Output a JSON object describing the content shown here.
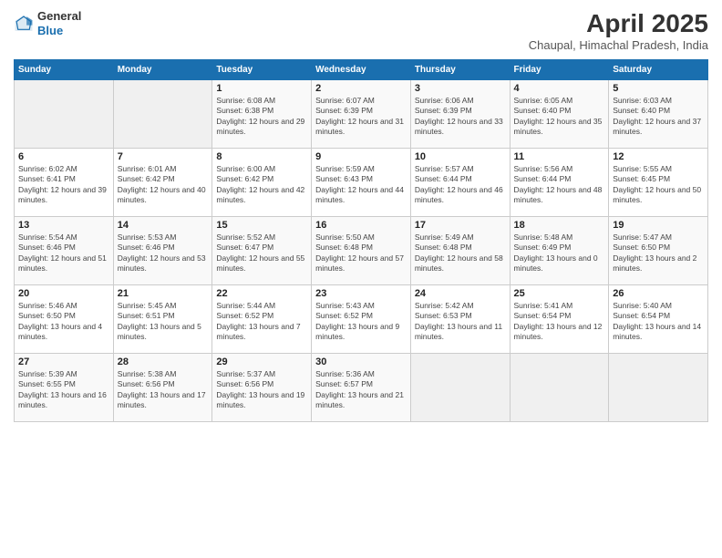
{
  "header": {
    "logo_line1": "General",
    "logo_line2": "Blue",
    "title": "April 2025",
    "location": "Chaupal, Himachal Pradesh, India"
  },
  "weekdays": [
    "Sunday",
    "Monday",
    "Tuesday",
    "Wednesday",
    "Thursday",
    "Friday",
    "Saturday"
  ],
  "weeks": [
    [
      {
        "day": "",
        "sunrise": "",
        "sunset": "",
        "daylight": ""
      },
      {
        "day": "",
        "sunrise": "",
        "sunset": "",
        "daylight": ""
      },
      {
        "day": "1",
        "sunrise": "Sunrise: 6:08 AM",
        "sunset": "Sunset: 6:38 PM",
        "daylight": "Daylight: 12 hours and 29 minutes."
      },
      {
        "day": "2",
        "sunrise": "Sunrise: 6:07 AM",
        "sunset": "Sunset: 6:39 PM",
        "daylight": "Daylight: 12 hours and 31 minutes."
      },
      {
        "day": "3",
        "sunrise": "Sunrise: 6:06 AM",
        "sunset": "Sunset: 6:39 PM",
        "daylight": "Daylight: 12 hours and 33 minutes."
      },
      {
        "day": "4",
        "sunrise": "Sunrise: 6:05 AM",
        "sunset": "Sunset: 6:40 PM",
        "daylight": "Daylight: 12 hours and 35 minutes."
      },
      {
        "day": "5",
        "sunrise": "Sunrise: 6:03 AM",
        "sunset": "Sunset: 6:40 PM",
        "daylight": "Daylight: 12 hours and 37 minutes."
      }
    ],
    [
      {
        "day": "6",
        "sunrise": "Sunrise: 6:02 AM",
        "sunset": "Sunset: 6:41 PM",
        "daylight": "Daylight: 12 hours and 39 minutes."
      },
      {
        "day": "7",
        "sunrise": "Sunrise: 6:01 AM",
        "sunset": "Sunset: 6:42 PM",
        "daylight": "Daylight: 12 hours and 40 minutes."
      },
      {
        "day": "8",
        "sunrise": "Sunrise: 6:00 AM",
        "sunset": "Sunset: 6:42 PM",
        "daylight": "Daylight: 12 hours and 42 minutes."
      },
      {
        "day": "9",
        "sunrise": "Sunrise: 5:59 AM",
        "sunset": "Sunset: 6:43 PM",
        "daylight": "Daylight: 12 hours and 44 minutes."
      },
      {
        "day": "10",
        "sunrise": "Sunrise: 5:57 AM",
        "sunset": "Sunset: 6:44 PM",
        "daylight": "Daylight: 12 hours and 46 minutes."
      },
      {
        "day": "11",
        "sunrise": "Sunrise: 5:56 AM",
        "sunset": "Sunset: 6:44 PM",
        "daylight": "Daylight: 12 hours and 48 minutes."
      },
      {
        "day": "12",
        "sunrise": "Sunrise: 5:55 AM",
        "sunset": "Sunset: 6:45 PM",
        "daylight": "Daylight: 12 hours and 50 minutes."
      }
    ],
    [
      {
        "day": "13",
        "sunrise": "Sunrise: 5:54 AM",
        "sunset": "Sunset: 6:46 PM",
        "daylight": "Daylight: 12 hours and 51 minutes."
      },
      {
        "day": "14",
        "sunrise": "Sunrise: 5:53 AM",
        "sunset": "Sunset: 6:46 PM",
        "daylight": "Daylight: 12 hours and 53 minutes."
      },
      {
        "day": "15",
        "sunrise": "Sunrise: 5:52 AM",
        "sunset": "Sunset: 6:47 PM",
        "daylight": "Daylight: 12 hours and 55 minutes."
      },
      {
        "day": "16",
        "sunrise": "Sunrise: 5:50 AM",
        "sunset": "Sunset: 6:48 PM",
        "daylight": "Daylight: 12 hours and 57 minutes."
      },
      {
        "day": "17",
        "sunrise": "Sunrise: 5:49 AM",
        "sunset": "Sunset: 6:48 PM",
        "daylight": "Daylight: 12 hours and 58 minutes."
      },
      {
        "day": "18",
        "sunrise": "Sunrise: 5:48 AM",
        "sunset": "Sunset: 6:49 PM",
        "daylight": "Daylight: 13 hours and 0 minutes."
      },
      {
        "day": "19",
        "sunrise": "Sunrise: 5:47 AM",
        "sunset": "Sunset: 6:50 PM",
        "daylight": "Daylight: 13 hours and 2 minutes."
      }
    ],
    [
      {
        "day": "20",
        "sunrise": "Sunrise: 5:46 AM",
        "sunset": "Sunset: 6:50 PM",
        "daylight": "Daylight: 13 hours and 4 minutes."
      },
      {
        "day": "21",
        "sunrise": "Sunrise: 5:45 AM",
        "sunset": "Sunset: 6:51 PM",
        "daylight": "Daylight: 13 hours and 5 minutes."
      },
      {
        "day": "22",
        "sunrise": "Sunrise: 5:44 AM",
        "sunset": "Sunset: 6:52 PM",
        "daylight": "Daylight: 13 hours and 7 minutes."
      },
      {
        "day": "23",
        "sunrise": "Sunrise: 5:43 AM",
        "sunset": "Sunset: 6:52 PM",
        "daylight": "Daylight: 13 hours and 9 minutes."
      },
      {
        "day": "24",
        "sunrise": "Sunrise: 5:42 AM",
        "sunset": "Sunset: 6:53 PM",
        "daylight": "Daylight: 13 hours and 11 minutes."
      },
      {
        "day": "25",
        "sunrise": "Sunrise: 5:41 AM",
        "sunset": "Sunset: 6:54 PM",
        "daylight": "Daylight: 13 hours and 12 minutes."
      },
      {
        "day": "26",
        "sunrise": "Sunrise: 5:40 AM",
        "sunset": "Sunset: 6:54 PM",
        "daylight": "Daylight: 13 hours and 14 minutes."
      }
    ],
    [
      {
        "day": "27",
        "sunrise": "Sunrise: 5:39 AM",
        "sunset": "Sunset: 6:55 PM",
        "daylight": "Daylight: 13 hours and 16 minutes."
      },
      {
        "day": "28",
        "sunrise": "Sunrise: 5:38 AM",
        "sunset": "Sunset: 6:56 PM",
        "daylight": "Daylight: 13 hours and 17 minutes."
      },
      {
        "day": "29",
        "sunrise": "Sunrise: 5:37 AM",
        "sunset": "Sunset: 6:56 PM",
        "daylight": "Daylight: 13 hours and 19 minutes."
      },
      {
        "day": "30",
        "sunrise": "Sunrise: 5:36 AM",
        "sunset": "Sunset: 6:57 PM",
        "daylight": "Daylight: 13 hours and 21 minutes."
      },
      {
        "day": "",
        "sunrise": "",
        "sunset": "",
        "daylight": ""
      },
      {
        "day": "",
        "sunrise": "",
        "sunset": "",
        "daylight": ""
      },
      {
        "day": "",
        "sunrise": "",
        "sunset": "",
        "daylight": ""
      }
    ]
  ]
}
